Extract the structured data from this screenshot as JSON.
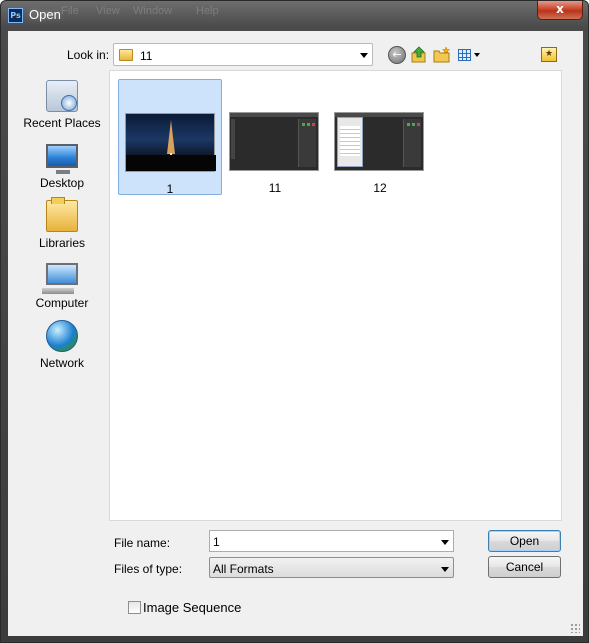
{
  "window": {
    "title": "Open",
    "app_icon": "photoshop-icon",
    "close_glyph": "x",
    "ghost_menu": [
      "File",
      "View",
      "Window",
      "Help"
    ]
  },
  "toolbar": {
    "look_in_label": "Look in:",
    "look_in_value": "11",
    "icons": [
      "back-icon",
      "up-folder-icon",
      "new-folder-icon",
      "view-menu-icon",
      "favorites-icon"
    ]
  },
  "places": [
    {
      "label": "Recent Places",
      "icon": "recent-places-icon"
    },
    {
      "label": "Desktop",
      "icon": "desktop-icon"
    },
    {
      "label": "Libraries",
      "icon": "libraries-icon"
    },
    {
      "label": "Computer",
      "icon": "computer-icon"
    },
    {
      "label": "Network",
      "icon": "network-icon"
    }
  ],
  "files": [
    {
      "name": "1",
      "selected": true,
      "thumbnail": "eiffel-tower-night"
    },
    {
      "name": "11",
      "selected": false,
      "thumbnail": "photoshop-screenshot"
    },
    {
      "name": "12",
      "selected": false,
      "thumbnail": "photoshop-screenshot-with-dialog"
    }
  ],
  "form": {
    "file_name_label": "File name:",
    "file_name_value": "1",
    "files_of_type_label": "Files of type:",
    "files_of_type_value": "All Formats"
  },
  "buttons": {
    "open": "Open",
    "cancel": "Cancel"
  },
  "options": {
    "image_sequence_label": "Image Sequence",
    "image_sequence_checked": false
  },
  "colors": {
    "selection": "#cce3fb",
    "selection_border": "#84acdd",
    "dialog_bg": "#f0f0f0",
    "close_button": "#c9462c"
  }
}
